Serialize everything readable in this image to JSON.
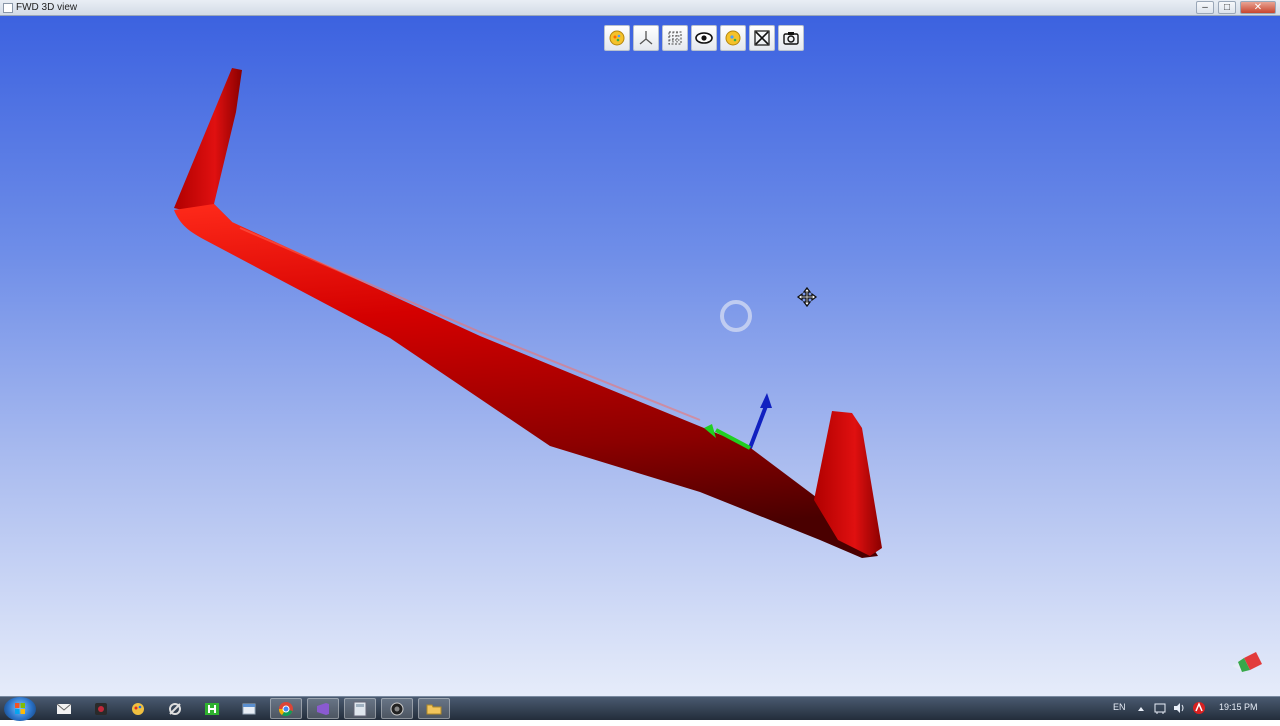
{
  "window": {
    "title": "FWD 3D view"
  },
  "titlebar_buttons": [
    "–",
    "□",
    "✕"
  ],
  "toolbar": {
    "buttons": [
      {
        "icon": "fit-view-icon"
      },
      {
        "icon": "axes-icon"
      },
      {
        "icon": "grid-icon"
      },
      {
        "icon": "eye-icon"
      },
      {
        "icon": "highlight-icon"
      },
      {
        "icon": "fullscreen-icon"
      },
      {
        "icon": "camera-icon"
      }
    ]
  },
  "scene": {
    "model_color": "#c40000",
    "background_top": "#3c62e0",
    "background_bottom": "#e6ecfa"
  },
  "taskbar": {
    "items": [
      {
        "icon": "mail-icon"
      },
      {
        "icon": "media-icon"
      },
      {
        "icon": "paint-icon"
      },
      {
        "icon": "tool-icon"
      },
      {
        "icon": "app-h-icon"
      },
      {
        "icon": "window-icon"
      },
      {
        "icon": "chrome-icon"
      },
      {
        "icon": "visual-studio-icon"
      },
      {
        "icon": "calculator-icon"
      },
      {
        "icon": "record-icon"
      },
      {
        "icon": "folder-icon"
      }
    ],
    "language": "EN",
    "time": "19:15 PM"
  }
}
